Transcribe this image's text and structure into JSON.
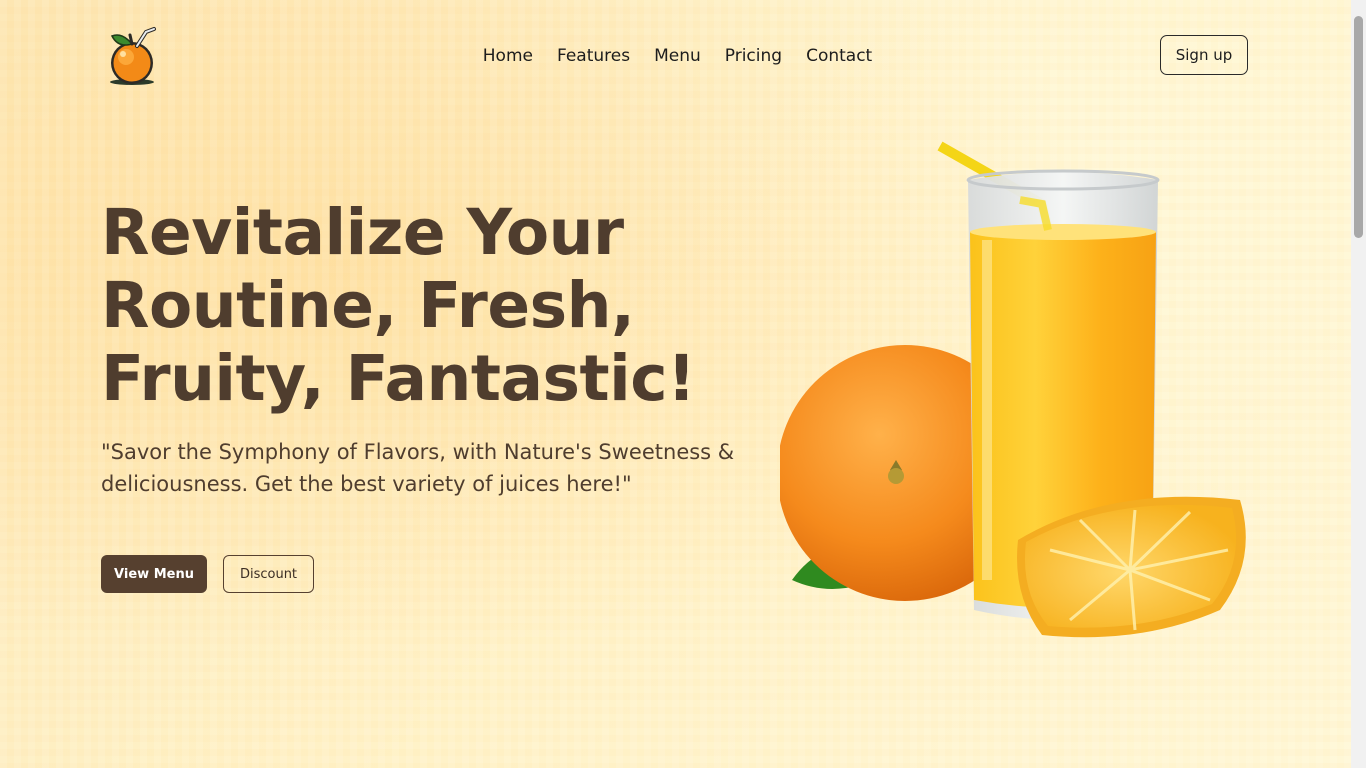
{
  "nav": {
    "items": [
      {
        "label": "Home"
      },
      {
        "label": "Features"
      },
      {
        "label": "Menu"
      },
      {
        "label": "Pricing"
      },
      {
        "label": "Contact"
      }
    ],
    "signup_label": "Sign up"
  },
  "hero": {
    "title_line_1": "Revitalize Your",
    "title_line_2": "Routine, Fresh,",
    "title_line_3": "Fruity, Fantastic!",
    "subtitle": "\"Savor the Symphony of Flavors, with Nature's Sweetness & deliciousness. Get the best variety of juices here!\"",
    "primary_button": "View Menu",
    "secondary_button": "Discount"
  },
  "colors": {
    "brand_brown": "#56402f",
    "heading": "#4f3d2e",
    "background": "#fef3c4",
    "orange": "#f5921e",
    "juice": "#fdb515"
  },
  "icons": {
    "logo": "orange-logo-icon"
  }
}
